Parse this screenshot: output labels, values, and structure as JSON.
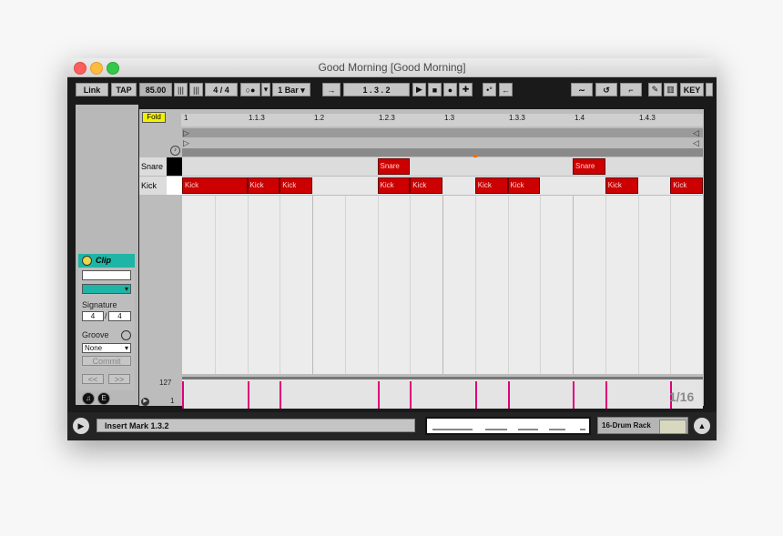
{
  "window": {
    "title": "Good Morning  [Good Morning]"
  },
  "transport": {
    "link": "Link",
    "tap": "TAP",
    "tempo": "85.00",
    "signature": "4  /  4",
    "quantize": "1 Bar",
    "position": "1 .   3 .   2",
    "key": "KEY"
  },
  "editor": {
    "fold": "Fold",
    "ruler_ticks": [
      "1",
      "1.1.3",
      "1.2",
      "1.2.3",
      "1.3",
      "1.3.3",
      "1.4",
      "1.4.3"
    ],
    "tracks": [
      {
        "name": "Snare",
        "notes": [
          {
            "label": "Snare",
            "start": 1.5,
            "length": 0.25
          },
          {
            "label": "Snare",
            "start": 3.0,
            "length": 0.25
          }
        ]
      },
      {
        "name": "Kick",
        "notes": [
          {
            "label": "Kick",
            "start": 0.0,
            "length": 0.5
          },
          {
            "label": "Kick",
            "start": 0.5,
            "length": 0.25
          },
          {
            "label": "Kick",
            "start": 0.75,
            "length": 0.25
          },
          {
            "label": "Kick",
            "start": 1.5,
            "length": 0.25
          },
          {
            "label": "Kick",
            "start": 1.75,
            "length": 0.25
          },
          {
            "label": "Kick",
            "start": 2.25,
            "length": 0.25
          },
          {
            "label": "Kick",
            "start": 2.5,
            "length": 0.25
          },
          {
            "label": "Kick",
            "start": 3.25,
            "length": 0.25
          },
          {
            "label": "Kick",
            "start": 3.75,
            "length": 0.25
          }
        ]
      }
    ],
    "velocity_max": "127",
    "velocity_min": "1",
    "grid_label": "1/16"
  },
  "clip": {
    "header": "Clip",
    "signature_label": "Signature",
    "sig_num": "4",
    "sig_den": "4",
    "groove_label": "Groove",
    "groove_value": "None",
    "commit": "Commit",
    "nav_left": "<<",
    "nav_right": ">>"
  },
  "status": {
    "text": "Insert Mark 1.3.2",
    "device": "16-Drum Rack"
  },
  "colors": {
    "note": "#cc0000",
    "velocity": "#e0007a",
    "clip_accent": "#1fb5a6"
  }
}
